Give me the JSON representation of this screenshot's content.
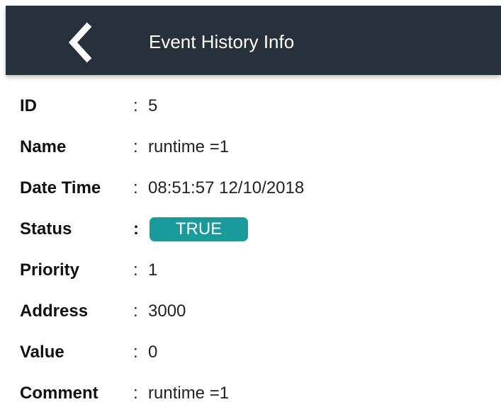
{
  "app_bar": {
    "title": "Event History Info",
    "back_icon": "chevron-left-icon",
    "background": "#28303b"
  },
  "fields": [
    {
      "label": "ID",
      "separator": ":",
      "value": "5"
    },
    {
      "label": "Name",
      "separator": ":",
      "value": "runtime =1"
    },
    {
      "label": "Date Time",
      "separator": ":",
      "value": "08:51:57 12/10/2018"
    },
    {
      "label": "Status",
      "separator": ":",
      "value": "TRUE"
    },
    {
      "label": "Priority",
      "separator": ":",
      "value": "1"
    },
    {
      "label": "Address",
      "separator": ":",
      "value": "3000"
    },
    {
      "label": "Value",
      "separator": ":",
      "value": "0"
    },
    {
      "label": "Comment",
      "separator": ":",
      "value": "runtime =1"
    }
  ],
  "colors": {
    "status_badge": "#1a9a9a"
  }
}
